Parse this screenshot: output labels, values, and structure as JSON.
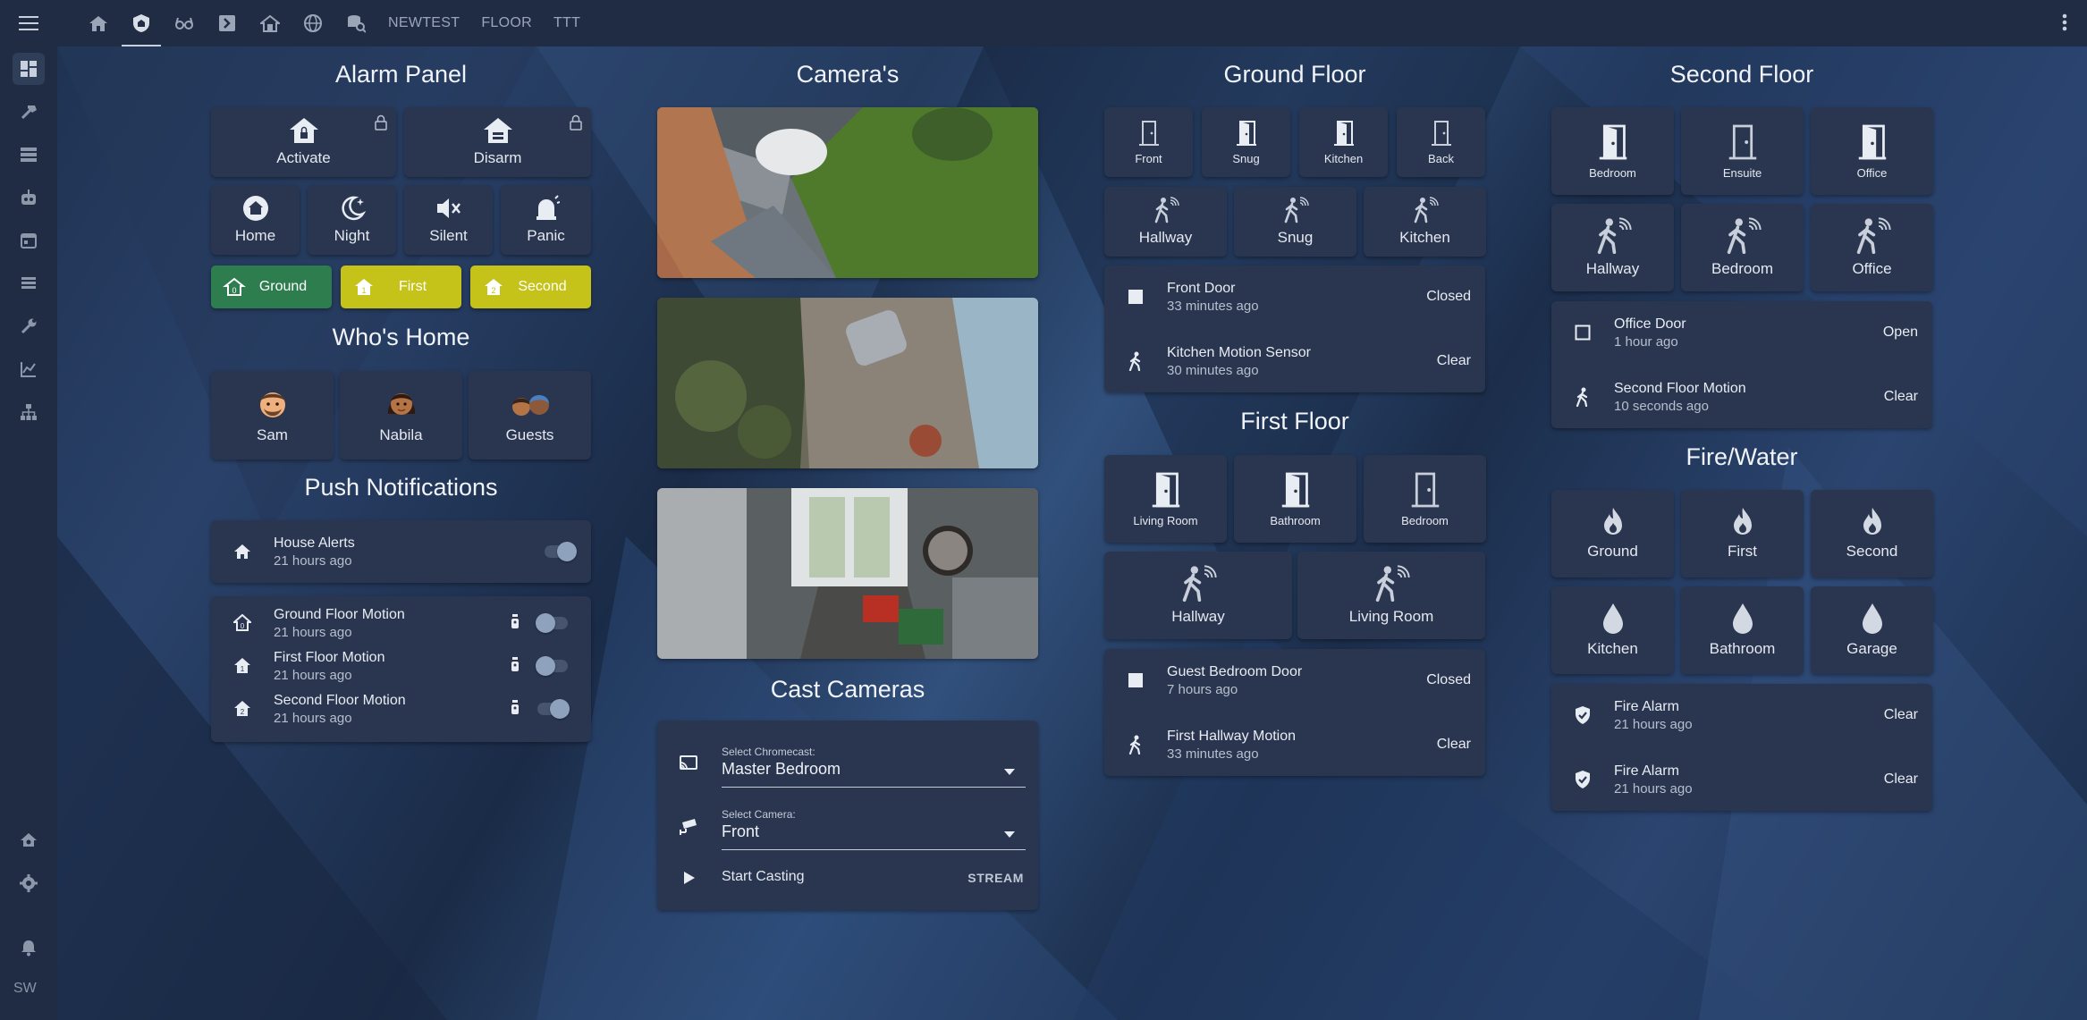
{
  "topbar": {
    "menu_icon": "hamburger-menu-icon",
    "tabs": [
      {
        "icon": "home-icon"
      },
      {
        "icon": "shield-home-icon"
      },
      {
        "icon": "glasses-icon"
      },
      {
        "icon": "chevron-box-icon"
      },
      {
        "icon": "home-floor-icon"
      },
      {
        "icon": "web-icon"
      },
      {
        "icon": "search-database-icon"
      }
    ],
    "text_tabs": [
      "NEWTEST",
      "FLOOR",
      "TTT"
    ],
    "more_icon": "dots-vertical-icon"
  },
  "sidebar": {
    "items": [
      "dashboard-icon",
      "hammer-icon",
      "server-icon",
      "robot-icon",
      "calendar-icon",
      "layers-icon",
      "wrench-icon",
      "chart-icon",
      "sitemap-icon"
    ],
    "bottom": [
      "home-gear-icon",
      "settings-icon",
      "bell-icon"
    ],
    "user_initials": "SW"
  },
  "alarm": {
    "title": "Alarm Panel",
    "actions": [
      {
        "label": "Activate"
      },
      {
        "label": "Disarm"
      }
    ],
    "modes": [
      {
        "label": "Home"
      },
      {
        "label": "Night"
      },
      {
        "label": "Silent"
      },
      {
        "label": "Panic"
      }
    ],
    "floors": [
      {
        "label": "Ground",
        "color": "#2e7d4f"
      },
      {
        "label": "First",
        "color": "#c5c21a"
      },
      {
        "label": "Second",
        "color": "#c5c21a"
      }
    ]
  },
  "whos_home": {
    "title": "Who's Home",
    "people": [
      {
        "label": "Sam"
      },
      {
        "label": "Nabila"
      },
      {
        "label": "Guests"
      }
    ]
  },
  "push": {
    "title": "Push Notifications",
    "house": {
      "name": "House Alerts",
      "time": "21 hours ago",
      "on": true
    },
    "items": [
      {
        "name": "Ground Floor Motion",
        "time": "21 hours ago",
        "on": false
      },
      {
        "name": "First Floor Motion",
        "time": "21 hours ago",
        "on": false
      },
      {
        "name": "Second Floor Motion",
        "time": "21 hours ago",
        "on": true
      }
    ]
  },
  "cameras": {
    "title": "Camera's"
  },
  "cast": {
    "title": "Cast Cameras",
    "chromecast_label": "Select Chromecast:",
    "chromecast_value": "Master Bedroom",
    "camera_label": "Select Camera:",
    "camera_value": "Front",
    "start_label": "Start Casting",
    "stream_label": "STREAM"
  },
  "ground": {
    "title": "Ground Floor",
    "doors": [
      {
        "label": "Front",
        "open": false
      },
      {
        "label": "Snug",
        "open": true
      },
      {
        "label": "Kitchen",
        "open": true
      },
      {
        "label": "Back",
        "open": false
      }
    ],
    "motion": [
      {
        "label": "Hallway"
      },
      {
        "label": "Snug"
      },
      {
        "label": "Kitchen"
      }
    ],
    "entities": [
      {
        "name": "Front Door",
        "time": "33 minutes ago",
        "state": "Closed",
        "icon": "square-icon"
      },
      {
        "name": "Kitchen Motion Sensor",
        "time": "30 minutes ago",
        "state": "Clear",
        "icon": "walk-icon"
      }
    ]
  },
  "first": {
    "title": "First Floor",
    "doors": [
      {
        "label": "Living Room",
        "open": true
      },
      {
        "label": "Bathroom",
        "open": true
      },
      {
        "label": "Bedroom",
        "open": false
      }
    ],
    "motion": [
      {
        "label": "Hallway"
      },
      {
        "label": "Living Room"
      }
    ],
    "entities": [
      {
        "name": "Guest Bedroom Door",
        "time": "7 hours ago",
        "state": "Closed",
        "icon": "square-icon"
      },
      {
        "name": "First Hallway Motion",
        "time": "33 minutes ago",
        "state": "Clear",
        "icon": "walk-icon"
      }
    ]
  },
  "second": {
    "title": "Second Floor",
    "doors": [
      {
        "label": "Bedroom",
        "open": true
      },
      {
        "label": "Ensuite",
        "open": false
      },
      {
        "label": "Office",
        "open": true
      }
    ],
    "motion": [
      {
        "label": "Hallway"
      },
      {
        "label": "Bedroom"
      },
      {
        "label": "Office"
      }
    ],
    "entities": [
      {
        "name": "Office Door",
        "time": "1 hour ago",
        "state": "Open",
        "icon": "square-outline-icon"
      },
      {
        "name": "Second Floor Motion",
        "time": "10 seconds ago",
        "state": "Clear",
        "icon": "walk-icon"
      }
    ]
  },
  "firewater": {
    "title": "Fire/Water",
    "fire": [
      {
        "label": "Ground"
      },
      {
        "label": "First"
      },
      {
        "label": "Second"
      }
    ],
    "water": [
      {
        "label": "Kitchen"
      },
      {
        "label": "Bathroom"
      },
      {
        "label": "Garage"
      }
    ],
    "entities": [
      {
        "name": "Fire Alarm",
        "time": "21 hours ago",
        "state": "Clear"
      },
      {
        "name": "Fire Alarm",
        "time": "21 hours ago",
        "state": "Clear"
      }
    ]
  }
}
